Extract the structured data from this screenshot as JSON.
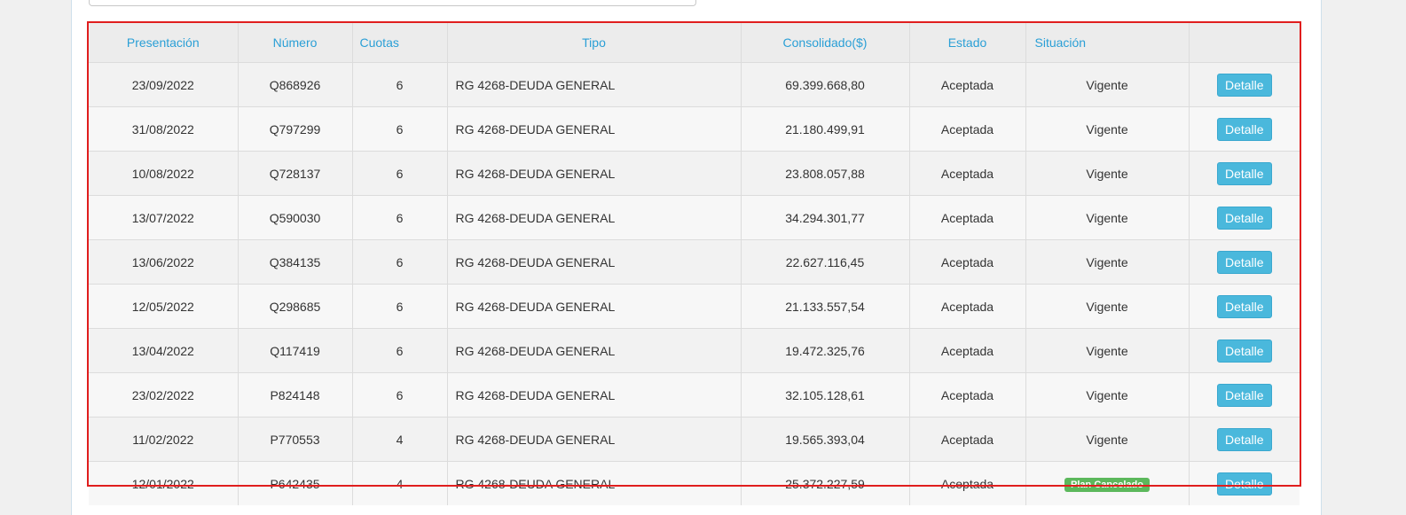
{
  "table": {
    "headers": {
      "presentacion": "Presentación",
      "numero": "Número",
      "cuotas": "Cuotas",
      "tipo": "Tipo",
      "consolidado": "Consolidado($)",
      "estado": "Estado",
      "situacion": "Situación"
    },
    "rows": [
      {
        "presentacion": "23/09/2022",
        "numero": "Q868926",
        "cuotas": "6",
        "tipo": "RG 4268-DEUDA GENERAL",
        "consolidado": "69.399.668,80",
        "estado": "Aceptada",
        "situacion": "Vigente",
        "action": "Detalle"
      },
      {
        "presentacion": "31/08/2022",
        "numero": "Q797299",
        "cuotas": "6",
        "tipo": "RG 4268-DEUDA GENERAL",
        "consolidado": "21.180.499,91",
        "estado": "Aceptada",
        "situacion": "Vigente",
        "action": "Detalle"
      },
      {
        "presentacion": "10/08/2022",
        "numero": "Q728137",
        "cuotas": "6",
        "tipo": "RG 4268-DEUDA GENERAL",
        "consolidado": "23.808.057,88",
        "estado": "Aceptada",
        "situacion": "Vigente",
        "action": "Detalle"
      },
      {
        "presentacion": "13/07/2022",
        "numero": "Q590030",
        "cuotas": "6",
        "tipo": "RG 4268-DEUDA GENERAL",
        "consolidado": "34.294.301,77",
        "estado": "Aceptada",
        "situacion": "Vigente",
        "action": "Detalle"
      },
      {
        "presentacion": "13/06/2022",
        "numero": "Q384135",
        "cuotas": "6",
        "tipo": "RG 4268-DEUDA GENERAL",
        "consolidado": "22.627.116,45",
        "estado": "Aceptada",
        "situacion": "Vigente",
        "action": "Detalle"
      },
      {
        "presentacion": "12/05/2022",
        "numero": "Q298685",
        "cuotas": "6",
        "tipo": "RG 4268-DEUDA GENERAL",
        "consolidado": "21.133.557,54",
        "estado": "Aceptada",
        "situacion": "Vigente",
        "action": "Detalle"
      },
      {
        "presentacion": "13/04/2022",
        "numero": "Q117419",
        "cuotas": "6",
        "tipo": "RG 4268-DEUDA GENERAL",
        "consolidado": "19.472.325,76",
        "estado": "Aceptada",
        "situacion": "Vigente",
        "action": "Detalle"
      },
      {
        "presentacion": "23/02/2022",
        "numero": "P824148",
        "cuotas": "6",
        "tipo": "RG 4268-DEUDA GENERAL",
        "consolidado": "32.105.128,61",
        "estado": "Aceptada",
        "situacion": "Vigente",
        "action": "Detalle"
      },
      {
        "presentacion": "11/02/2022",
        "numero": "P770553",
        "cuotas": "4",
        "tipo": "RG 4268-DEUDA GENERAL",
        "consolidado": "19.565.393,04",
        "estado": "Aceptada",
        "situacion": "Vigente",
        "action": "Detalle"
      },
      {
        "presentacion": "12/01/2022",
        "numero": "P642435",
        "cuotas": "4",
        "tipo": "RG 4268-DEUDA GENERAL",
        "consolidado": "25.372.227,59",
        "estado": "Aceptada",
        "situacion": "Plan Cancelado",
        "situacion_badge": true,
        "action": "Detalle"
      }
    ]
  },
  "colors": {
    "header_text": "#2a9fd6",
    "button": "#4ab8dc",
    "badge_green": "#5cb85c",
    "highlight": "#e01e1e"
  }
}
